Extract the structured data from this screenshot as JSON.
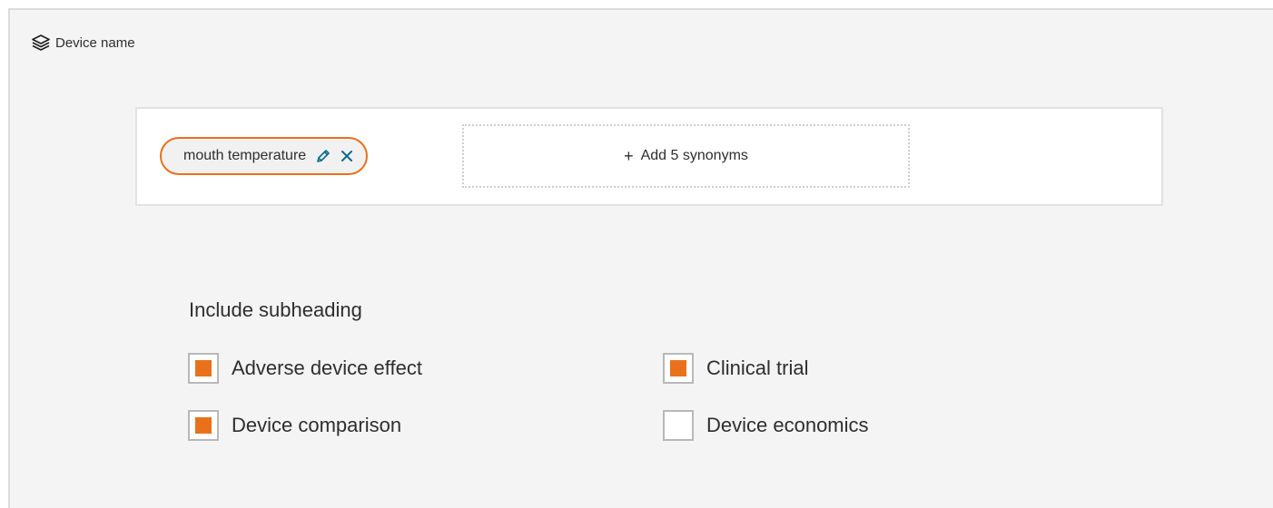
{
  "panel": {
    "title": "Device name",
    "title_icon": "layers-icon"
  },
  "term": {
    "chip_label": "mouth temperature",
    "edit_icon": "pencil-icon",
    "remove_icon": "close-icon",
    "add_synonyms_label": "Add 5 synonyms",
    "add_icon": "plus-icon"
  },
  "subheading": {
    "title": "Include subheading",
    "options": [
      {
        "label": "Adverse device effect",
        "checked": true
      },
      {
        "label": "Clinical trial",
        "checked": true
      },
      {
        "label": "Device comparison",
        "checked": true
      },
      {
        "label": "Device economics",
        "checked": false
      }
    ]
  },
  "colors": {
    "accent": "#e9711c",
    "panel_bg": "#f4f4f4",
    "icon_teal": "#0a6a8a"
  }
}
